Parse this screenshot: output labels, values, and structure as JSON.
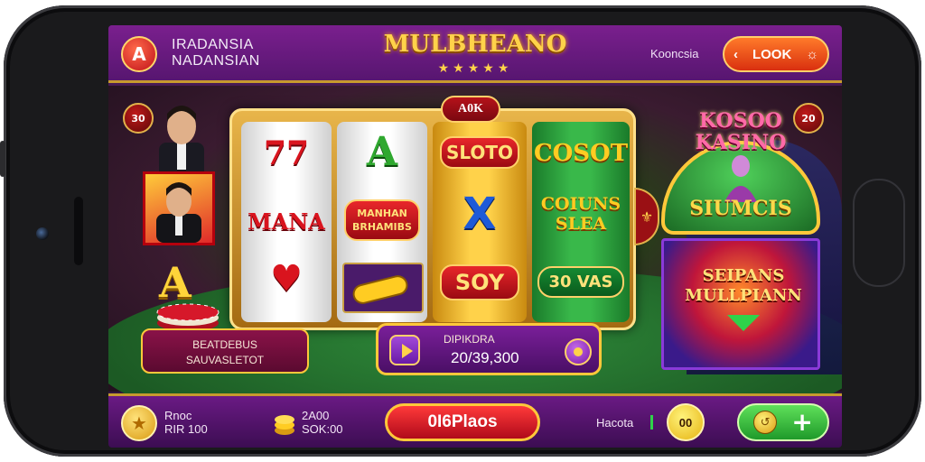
{
  "header": {
    "logo_letter": "A",
    "brand_line1": "IRADANSIA",
    "brand_line2": "NADANSIAN",
    "title": "MULBHEANO",
    "stars": "★★★★★",
    "region": "Kooncsia",
    "look_button": "LOOK",
    "look_left_icon": "‹",
    "look_right_icon": "☼"
  },
  "badges": {
    "left": "30",
    "right": "20"
  },
  "machine": {
    "label": "A0K",
    "reel1": [
      "77",
      "MANA",
      "♥"
    ],
    "reel2": [
      "A",
      "MANHAN BRHAMIBS"
    ],
    "reel3": [
      "SLOTO",
      "X",
      "SOY"
    ],
    "reel4": [
      "COSOT",
      "COIUNS SLEA",
      "30 VAS"
    ],
    "big_letter": "A"
  },
  "promos": {
    "kasino_title": "KOSOO\nKASINO",
    "kasino_sub": "SIUMCIS",
    "sensasi": "SEIPANS\nMULLPIANN"
  },
  "panels": {
    "left_line1": "BEATDEBUS",
    "left_line2": "SAUVASLETOT",
    "center_label": "DIPIKDRA",
    "center_value": "20/39,300"
  },
  "bottom": {
    "label1_line1": "Rnoc",
    "label1_line2": "RIR 100",
    "label2_line1": "2A00",
    "label2_line2": "SOK:00",
    "main_button": "0I6Plaos",
    "status_text": "Hacota",
    "level": "00"
  },
  "colors": {
    "frame": "#1a1a1c",
    "header_purple": "#7a1f8e",
    "accent_gold": "#ffc83a",
    "cta_red": "#e8262a",
    "cta_green": "#2fbf3a"
  }
}
